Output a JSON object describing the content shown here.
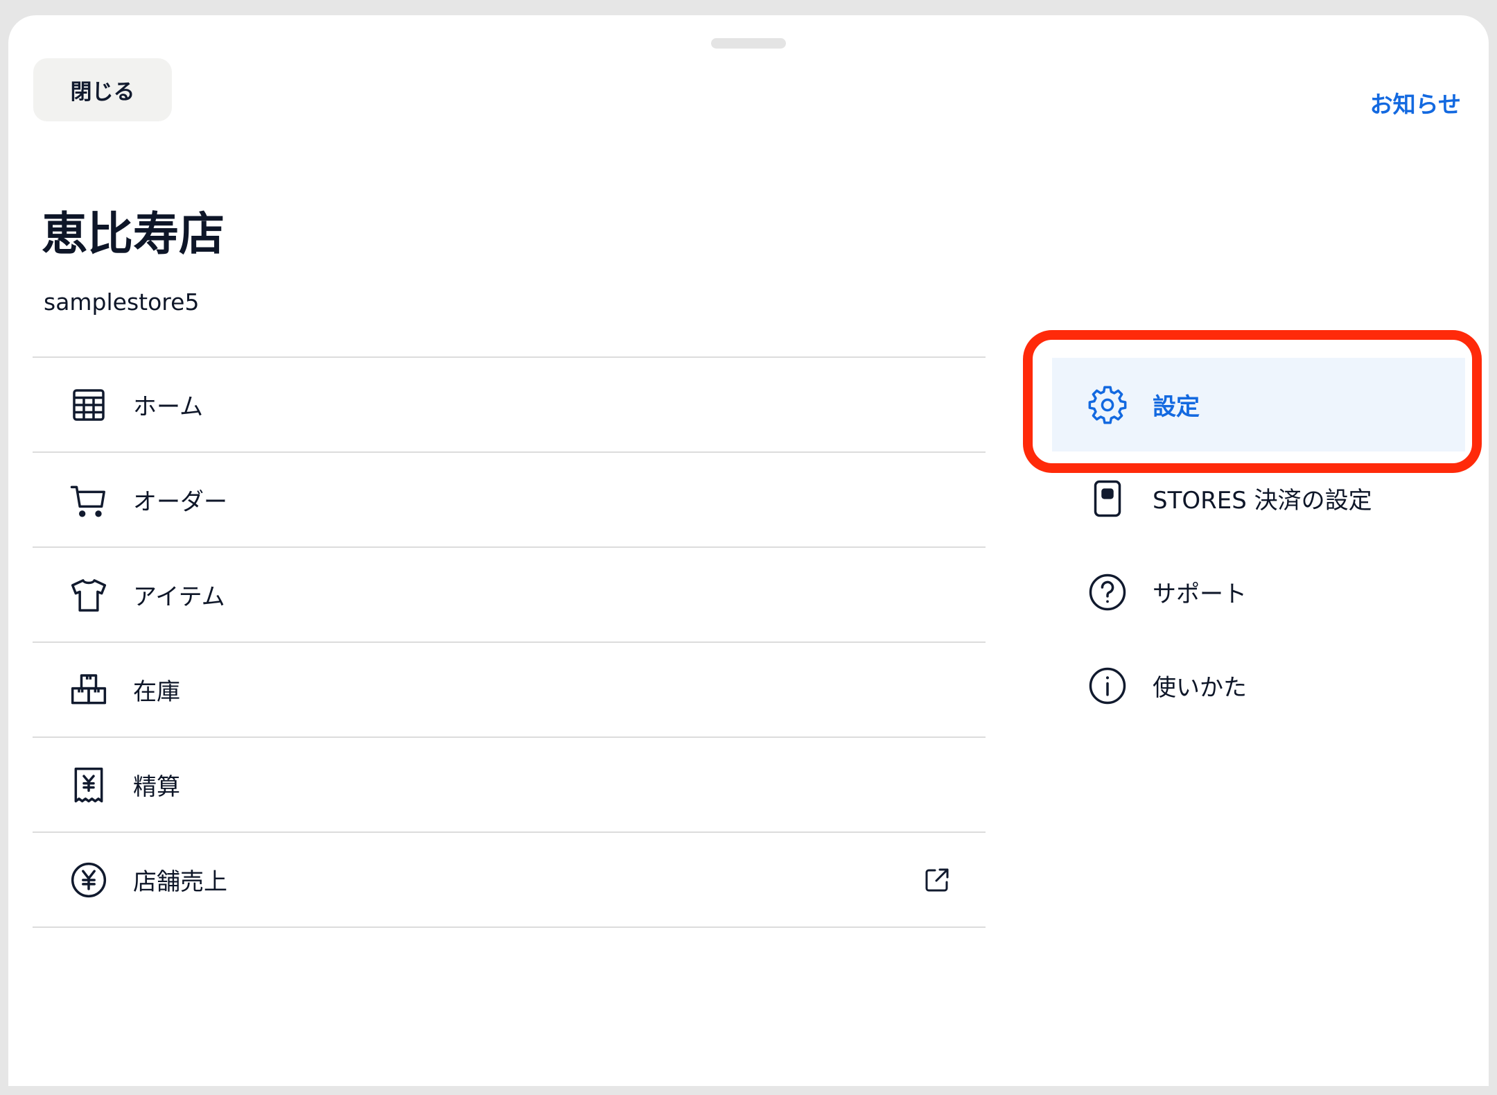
{
  "header": {
    "close_label": "閉じる",
    "news_label": "お知らせ"
  },
  "store": {
    "name": "恵比寿店",
    "id": "samplestore5"
  },
  "main_menu": [
    {
      "label": "ホーム",
      "icon": "grid-icon"
    },
    {
      "label": "オーダー",
      "icon": "cart-icon"
    },
    {
      "label": "アイテム",
      "icon": "tshirt-icon"
    },
    {
      "label": "在庫",
      "icon": "boxes-icon"
    },
    {
      "label": "精算",
      "icon": "receipt-yen-icon"
    },
    {
      "label": "店舗売上",
      "icon": "yen-circle-icon",
      "external": true
    }
  ],
  "side_menu": [
    {
      "label": "設定",
      "icon": "gear-icon",
      "active": true
    },
    {
      "label": "STORES 決済の設定",
      "icon": "card-terminal-icon"
    },
    {
      "label": "サポート",
      "icon": "question-circle-icon"
    },
    {
      "label": "使いかた",
      "icon": "info-circle-icon"
    }
  ],
  "colors": {
    "accent": "#1369e0",
    "highlight": "#ff2a0a",
    "active_bg": "#eef5fd",
    "text": "#0e1628"
  }
}
